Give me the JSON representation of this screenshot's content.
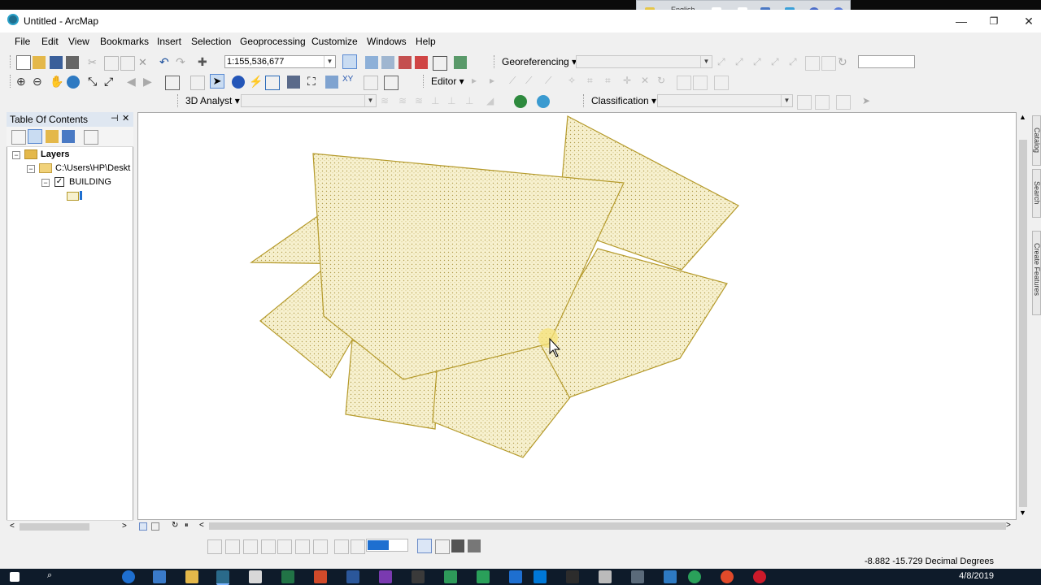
{
  "window": {
    "title": "Untitled - ArcMap",
    "minimize": "—",
    "restore": "❐",
    "close": "✕"
  },
  "language_bar": {
    "language": "English"
  },
  "menu": [
    "File",
    "Edit",
    "View",
    "Bookmarks",
    "Insert",
    "Selection",
    "Geoprocessing",
    "Customize",
    "Windows",
    "Help"
  ],
  "standard_toolbar": {
    "scale": "1:155,536,677"
  },
  "georef_toolbar": {
    "label": "Georeferencing ▾"
  },
  "editor_toolbar": {
    "label": "Editor ▾"
  },
  "analyst_toolbar": {
    "label": "3D Analyst ▾"
  },
  "classification_toolbar": {
    "label": "Classification ▾"
  },
  "toc": {
    "title": "Table Of Contents",
    "pin": "⊣",
    "close": "✕",
    "layers_label": "Layers",
    "folder_label": "C:\\Users\\HP\\Deskt",
    "layer_label": "BUILDING",
    "layer_checked": true
  },
  "dock_tabs": [
    "Catalog",
    "Search",
    "Create Features"
  ],
  "status": {
    "coordinates": "-8.882  -15.729 Decimal Degrees"
  },
  "taskbar": {
    "date": "4/8/2019"
  },
  "colors": {
    "polygon_fill": "#f7f1cf",
    "polygon_stroke": "#b59a2b",
    "highlight": "#f5e27a",
    "taskbar": "#0e1b2a"
  }
}
